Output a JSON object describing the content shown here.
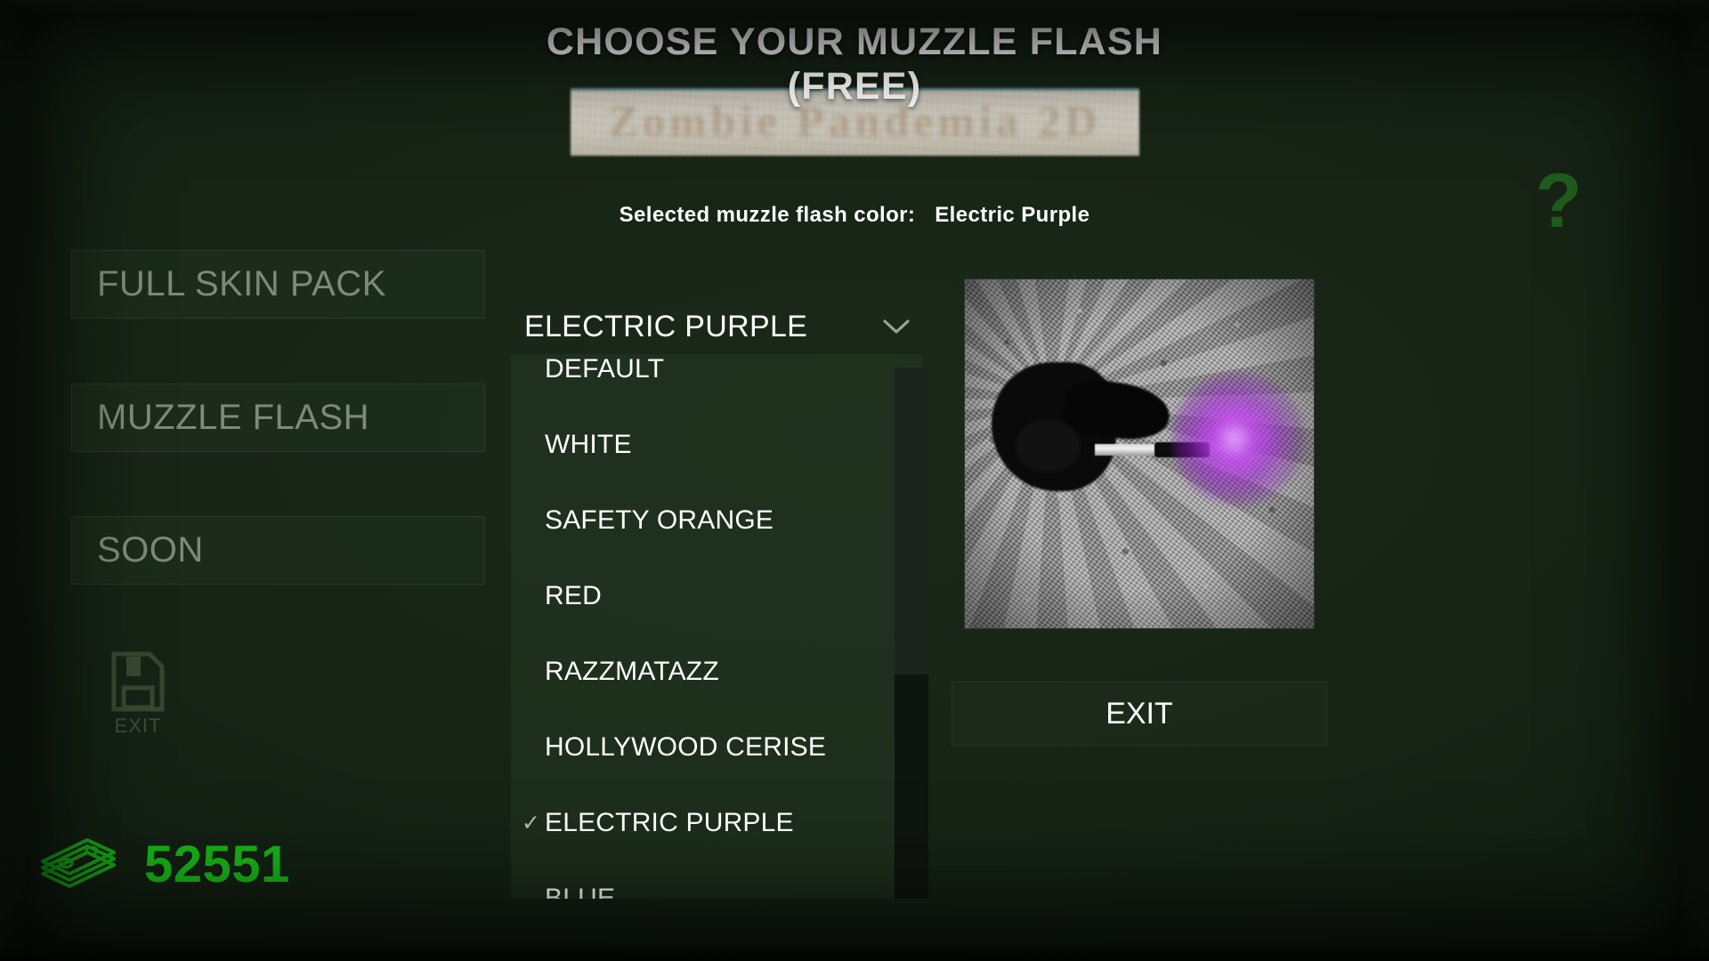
{
  "header": {
    "title_line1": "CHOOSE YOUR MUZZLE FLASH",
    "title_line2": "(FREE)",
    "banner_text": "Zombie Pandemia 2D",
    "selected_label": "Selected muzzle flash color:",
    "selected_value": "Electric Purple",
    "help_icon": "?"
  },
  "sidebar": {
    "items": [
      {
        "label": "FULL SKIN PACK"
      },
      {
        "label": "MUZZLE FLASH"
      },
      {
        "label": "SOON"
      }
    ],
    "save_exit_label": "EXIT",
    "save_exit_icon": "floppy-disk-icon",
    "money_icon": "money-stack-icon",
    "money_value": "52551"
  },
  "dropdown": {
    "selected": "ELECTRIC PURPLE",
    "chevron_icon": "chevron-down-icon",
    "check_glyph": "✓",
    "options": [
      {
        "label": "DEFAULT",
        "checked": false
      },
      {
        "label": "WHITE",
        "checked": false
      },
      {
        "label": "SAFETY ORANGE",
        "checked": false
      },
      {
        "label": "RED",
        "checked": false
      },
      {
        "label": "RAZZMATAZZ",
        "checked": false
      },
      {
        "label": "HOLLYWOOD CERISE",
        "checked": false
      },
      {
        "label": "ELECTRIC PURPLE",
        "checked": true
      },
      {
        "label": "BLUE",
        "checked": false
      }
    ]
  },
  "preview": {
    "alt": "top-down view of character firing a suppressed pistol with a purple muzzle flash on concrete",
    "flash_color": "#c140f0"
  },
  "exit_button": {
    "label": "EXIT"
  },
  "colors": {
    "background": "#162315",
    "text_primary": "#ffffff",
    "text_muted": "#7d8a79",
    "money_green": "#17b217",
    "help_green": "#1f5c1d",
    "flash_purple": "#c140f0"
  }
}
